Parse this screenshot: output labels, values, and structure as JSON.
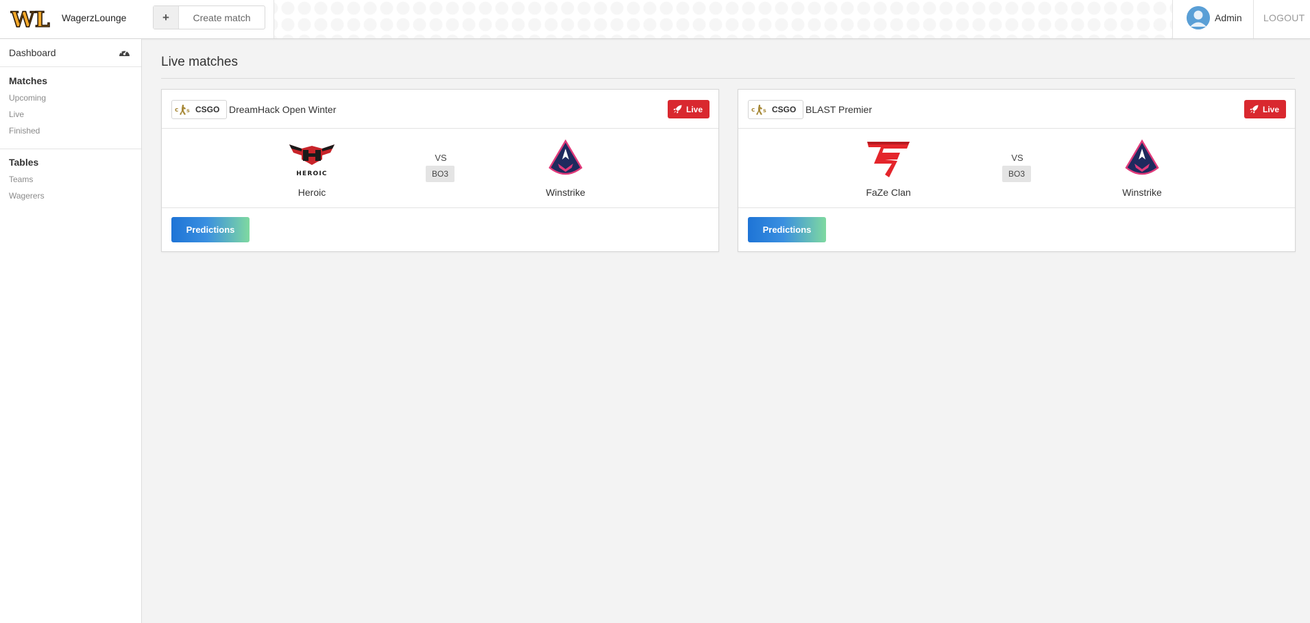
{
  "brand": {
    "logo_text": "WL",
    "name": "WagerzLounge"
  },
  "toolbar": {
    "create_label": "Create match"
  },
  "user": {
    "name": "Admin",
    "logout_label": "LOGOUT"
  },
  "sidebar": {
    "dashboard_label": "Dashboard",
    "sections": [
      {
        "title": "Matches",
        "items": [
          "Upcoming",
          "Live",
          "Finished"
        ]
      },
      {
        "title": "Tables",
        "items": [
          "Teams",
          "Wagerers"
        ]
      }
    ]
  },
  "main": {
    "title": "Live matches",
    "matches": [
      {
        "game": "CSGO",
        "event": "DreamHack Open Winter",
        "status": "Live",
        "team1": {
          "name": "Heroic",
          "logo_text": "HEROIC"
        },
        "team2": {
          "name": "Winstrike"
        },
        "vs_label": "VS",
        "format": "BO3",
        "action_label": "Predictions"
      },
      {
        "game": "CSGO",
        "event": "BLAST Premier",
        "status": "Live",
        "team1": {
          "name": "FaZe Clan"
        },
        "team2": {
          "name": "Winstrike"
        },
        "vs_label": "VS",
        "format": "BO3",
        "action_label": "Predictions"
      }
    ]
  },
  "colors": {
    "live_badge": "#d9282f",
    "predictions_gradient_start": "#1e74d6",
    "predictions_gradient_end": "#7fd9a0",
    "brand_logo": "#f0a020"
  }
}
